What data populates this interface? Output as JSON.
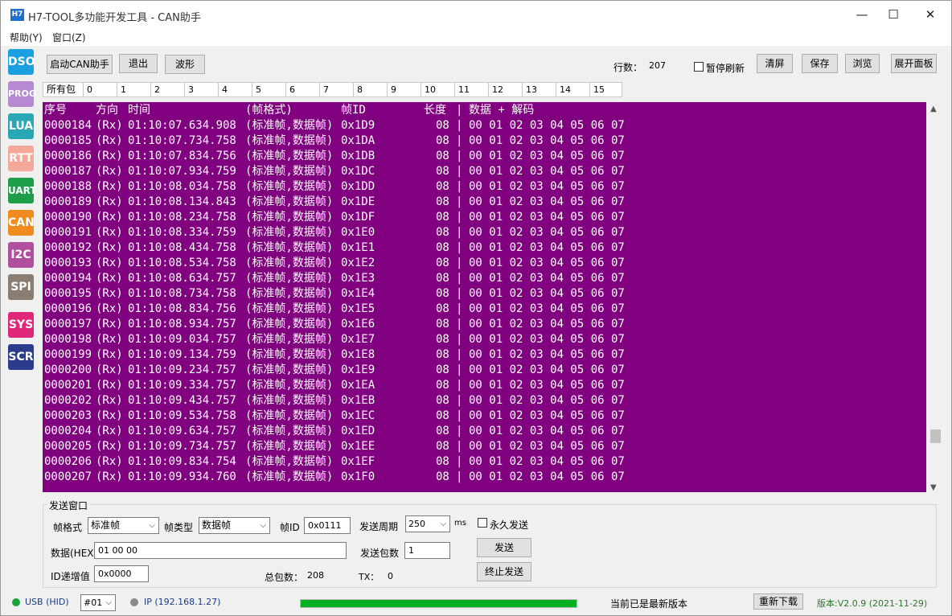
{
  "window": {
    "icon_text": "H7",
    "title": "H7-TOOL多功能开发工具 - CAN助手",
    "minimize": "—",
    "maximize": "☐",
    "close": "✕"
  },
  "menu": [
    {
      "label": "帮助(Y)"
    },
    {
      "label": "窗口(Z)"
    }
  ],
  "sidebar": [
    {
      "label": "DSO",
      "color": "#1aa0e0"
    },
    {
      "label": "PROG",
      "color": "#b58ad0"
    },
    {
      "label": "LUA",
      "color": "#2aa7b4"
    },
    {
      "label": "RTT",
      "color": "#f4a89a"
    },
    {
      "label": "UART",
      "color": "#1f9e4a"
    },
    {
      "label": "CAN",
      "color": "#f08c1e"
    },
    {
      "label": "I2C",
      "color": "#b04fa0"
    },
    {
      "label": "SPI",
      "color": "#8a7d72"
    },
    {
      "label": "SYS",
      "color": "#e0287a"
    },
    {
      "label": "SCR",
      "color": "#2b3d8a"
    }
  ],
  "toolbar": {
    "start_label": "启动CAN助手",
    "exit_label": "退出",
    "wave_label": "波形",
    "rows_label": "行数：",
    "rows_value": "207",
    "pause_label": "暂停刷新",
    "clear_label": "清屏",
    "save_label": "保存",
    "browse_label": "浏览",
    "expand_label": "展开面板"
  },
  "tabs": [
    "所有包",
    "0",
    "1",
    "2",
    "3",
    "4",
    "5",
    "6",
    "7",
    "8",
    "9",
    "10",
    "11",
    "12",
    "13",
    "14",
    "15"
  ],
  "table": {
    "header": {
      "seq": "序号",
      "dir": "方向",
      "time": "时间",
      "fmt": "(帧格式)",
      "id": "帧ID",
      "len": "长度",
      "sep": "|",
      "data": "数据 + 解码"
    },
    "rows": [
      {
        "seq": "0000184",
        "dir": "(Rx)",
        "time": "01:10:07.634.908",
        "fmt": "(标准帧,数据帧)",
        "id": "0x1D9",
        "len": "08",
        "sep": "|",
        "data": "00 01 02 03 04 05 06 07"
      },
      {
        "seq": "0000185",
        "dir": "(Rx)",
        "time": "01:10:07.734.758",
        "fmt": "(标准帧,数据帧)",
        "id": "0x1DA",
        "len": "08",
        "sep": "|",
        "data": "00 01 02 03 04 05 06 07"
      },
      {
        "seq": "0000186",
        "dir": "(Rx)",
        "time": "01:10:07.834.756",
        "fmt": "(标准帧,数据帧)",
        "id": "0x1DB",
        "len": "08",
        "sep": "|",
        "data": "00 01 02 03 04 05 06 07"
      },
      {
        "seq": "0000187",
        "dir": "(Rx)",
        "time": "01:10:07.934.759",
        "fmt": "(标准帧,数据帧)",
        "id": "0x1DC",
        "len": "08",
        "sep": "|",
        "data": "00 01 02 03 04 05 06 07"
      },
      {
        "seq": "0000188",
        "dir": "(Rx)",
        "time": "01:10:08.034.758",
        "fmt": "(标准帧,数据帧)",
        "id": "0x1DD",
        "len": "08",
        "sep": "|",
        "data": "00 01 02 03 04 05 06 07"
      },
      {
        "seq": "0000189",
        "dir": "(Rx)",
        "time": "01:10:08.134.843",
        "fmt": "(标准帧,数据帧)",
        "id": "0x1DE",
        "len": "08",
        "sep": "|",
        "data": "00 01 02 03 04 05 06 07"
      },
      {
        "seq": "0000190",
        "dir": "(Rx)",
        "time": "01:10:08.234.758",
        "fmt": "(标准帧,数据帧)",
        "id": "0x1DF",
        "len": "08",
        "sep": "|",
        "data": "00 01 02 03 04 05 06 07"
      },
      {
        "seq": "0000191",
        "dir": "(Rx)",
        "time": "01:10:08.334.759",
        "fmt": "(标准帧,数据帧)",
        "id": "0x1E0",
        "len": "08",
        "sep": "|",
        "data": "00 01 02 03 04 05 06 07"
      },
      {
        "seq": "0000192",
        "dir": "(Rx)",
        "time": "01:10:08.434.758",
        "fmt": "(标准帧,数据帧)",
        "id": "0x1E1",
        "len": "08",
        "sep": "|",
        "data": "00 01 02 03 04 05 06 07"
      },
      {
        "seq": "0000193",
        "dir": "(Rx)",
        "time": "01:10:08.534.758",
        "fmt": "(标准帧,数据帧)",
        "id": "0x1E2",
        "len": "08",
        "sep": "|",
        "data": "00 01 02 03 04 05 06 07"
      },
      {
        "seq": "0000194",
        "dir": "(Rx)",
        "time": "01:10:08.634.757",
        "fmt": "(标准帧,数据帧)",
        "id": "0x1E3",
        "len": "08",
        "sep": "|",
        "data": "00 01 02 03 04 05 06 07"
      },
      {
        "seq": "0000195",
        "dir": "(Rx)",
        "time": "01:10:08.734.758",
        "fmt": "(标准帧,数据帧)",
        "id": "0x1E4",
        "len": "08",
        "sep": "|",
        "data": "00 01 02 03 04 05 06 07"
      },
      {
        "seq": "0000196",
        "dir": "(Rx)",
        "time": "01:10:08.834.756",
        "fmt": "(标准帧,数据帧)",
        "id": "0x1E5",
        "len": "08",
        "sep": "|",
        "data": "00 01 02 03 04 05 06 07"
      },
      {
        "seq": "0000197",
        "dir": "(Rx)",
        "time": "01:10:08.934.757",
        "fmt": "(标准帧,数据帧)",
        "id": "0x1E6",
        "len": "08",
        "sep": "|",
        "data": "00 01 02 03 04 05 06 07"
      },
      {
        "seq": "0000198",
        "dir": "(Rx)",
        "time": "01:10:09.034.757",
        "fmt": "(标准帧,数据帧)",
        "id": "0x1E7",
        "len": "08",
        "sep": "|",
        "data": "00 01 02 03 04 05 06 07"
      },
      {
        "seq": "0000199",
        "dir": "(Rx)",
        "time": "01:10:09.134.759",
        "fmt": "(标准帧,数据帧)",
        "id": "0x1E8",
        "len": "08",
        "sep": "|",
        "data": "00 01 02 03 04 05 06 07"
      },
      {
        "seq": "0000200",
        "dir": "(Rx)",
        "time": "01:10:09.234.757",
        "fmt": "(标准帧,数据帧)",
        "id": "0x1E9",
        "len": "08",
        "sep": "|",
        "data": "00 01 02 03 04 05 06 07"
      },
      {
        "seq": "0000201",
        "dir": "(Rx)",
        "time": "01:10:09.334.757",
        "fmt": "(标准帧,数据帧)",
        "id": "0x1EA",
        "len": "08",
        "sep": "|",
        "data": "00 01 02 03 04 05 06 07"
      },
      {
        "seq": "0000202",
        "dir": "(Rx)",
        "time": "01:10:09.434.757",
        "fmt": "(标准帧,数据帧)",
        "id": "0x1EB",
        "len": "08",
        "sep": "|",
        "data": "00 01 02 03 04 05 06 07"
      },
      {
        "seq": "0000203",
        "dir": "(Rx)",
        "time": "01:10:09.534.758",
        "fmt": "(标准帧,数据帧)",
        "id": "0x1EC",
        "len": "08",
        "sep": "|",
        "data": "00 01 02 03 04 05 06 07"
      },
      {
        "seq": "0000204",
        "dir": "(Rx)",
        "time": "01:10:09.634.757",
        "fmt": "(标准帧,数据帧)",
        "id": "0x1ED",
        "len": "08",
        "sep": "|",
        "data": "00 01 02 03 04 05 06 07"
      },
      {
        "seq": "0000205",
        "dir": "(Rx)",
        "time": "01:10:09.734.757",
        "fmt": "(标准帧,数据帧)",
        "id": "0x1EE",
        "len": "08",
        "sep": "|",
        "data": "00 01 02 03 04 05 06 07"
      },
      {
        "seq": "0000206",
        "dir": "(Rx)",
        "time": "01:10:09.834.754",
        "fmt": "(标准帧,数据帧)",
        "id": "0x1EF",
        "len": "08",
        "sep": "|",
        "data": "00 01 02 03 04 05 06 07"
      },
      {
        "seq": "0000207",
        "dir": "(Rx)",
        "time": "01:10:09.934.760",
        "fmt": "(标准帧,数据帧)",
        "id": "0x1F0",
        "len": "08",
        "sep": "|",
        "data": "00 01 02 03 04 05 06 07"
      }
    ]
  },
  "scroll": {
    "up": "▲",
    "down": "▼"
  },
  "send": {
    "group_title": "发送窗口",
    "frame_format_label": "帧格式",
    "frame_format_value": "标准帧",
    "frame_type_label": "帧类型",
    "frame_type_value": "数据帧",
    "frame_id_label": "帧ID",
    "frame_id_value": "0x0111",
    "period_label": "发送周期",
    "period_value": "250",
    "period_unit": "ms",
    "forever_label": "永久发送",
    "data_label": "数据(HEX)",
    "data_value": "01 00 00",
    "count_label": "发送包数",
    "count_value": "1",
    "send_label": "发送",
    "id_inc_label": "ID递增值",
    "id_inc_value": "0x0000",
    "total_label": "总包数：",
    "total_value": "208",
    "tx_label": "TX：",
    "tx_value": "0",
    "stop_label": "终止发送",
    "dropdown_arrow": "⌵"
  },
  "status": {
    "usb_label": "USB (HID)",
    "usb_color": "#1aa33a",
    "device_value": "#01",
    "ip_label": "IP (192.168.1.27)",
    "ip_color": "#8a8a8a",
    "progress": 1.0,
    "progress_color": "#06b025",
    "message": "当前已是最新版本",
    "redownload_label": "重新下载",
    "version": "版本:V2.0.9 (2021-11-29)",
    "version_color": "#2a7a2a"
  },
  "colors": {
    "data_background": "#800080",
    "data_text": "#ffffff"
  }
}
